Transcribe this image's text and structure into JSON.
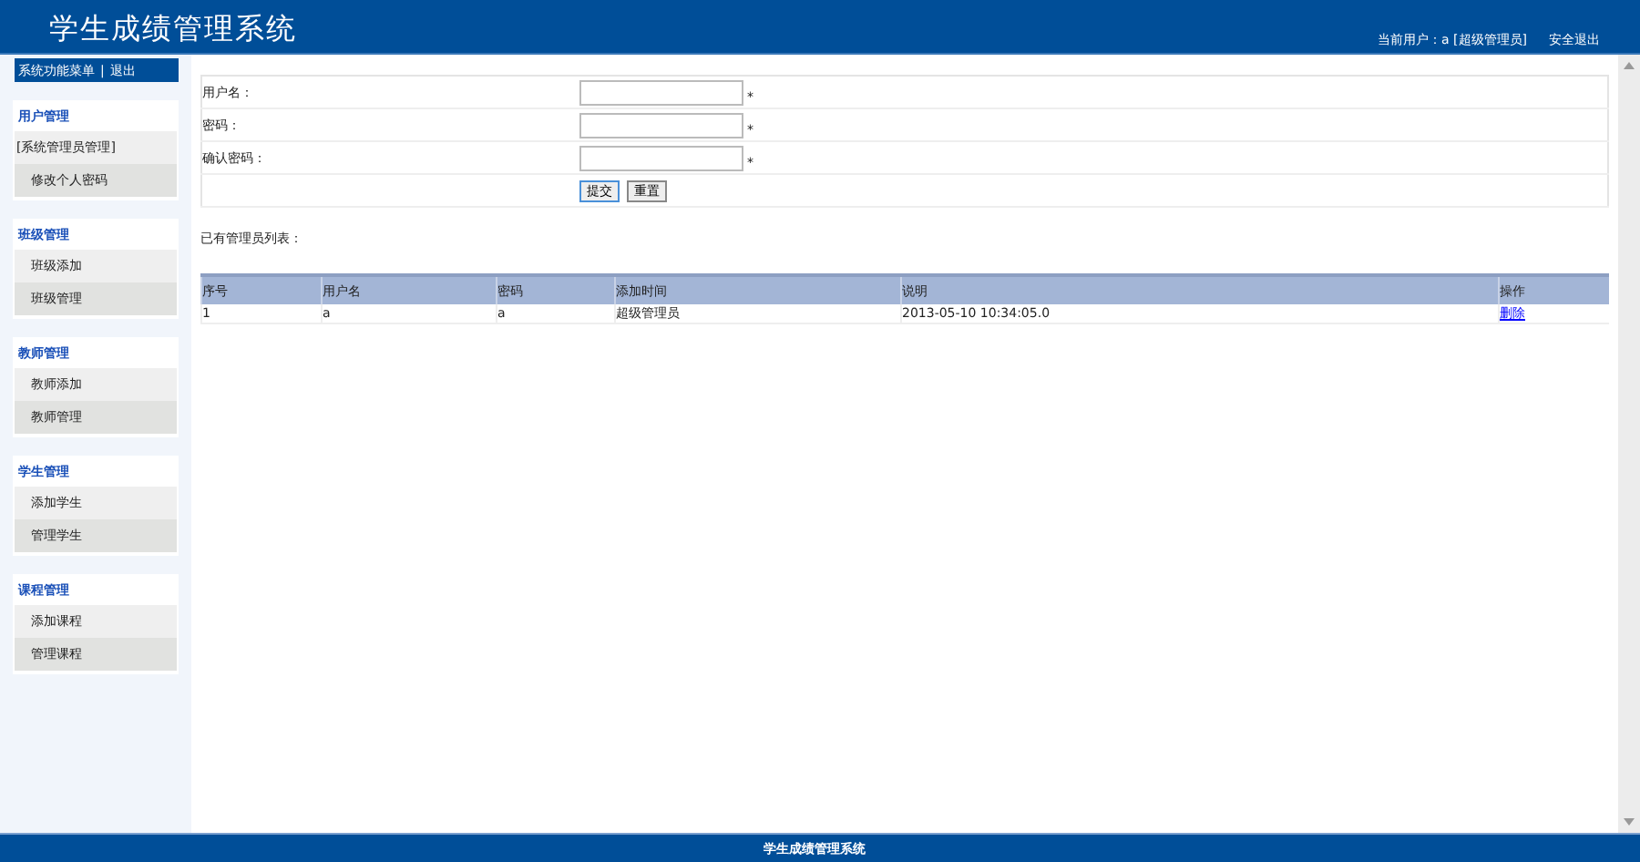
{
  "header": {
    "title": "学生成绩管理系统",
    "current_user": "当前用户：a [超级管理员]",
    "logout": "安全退出"
  },
  "sidebar": {
    "menu_title": "系统功能菜单",
    "menu_separator": "|",
    "menu_logout": "退出",
    "groups": [
      {
        "title": "用户管理",
        "items": [
          "[系统管理员管理]",
          "修改个人密码"
        ]
      },
      {
        "title": "班级管理",
        "items": [
          "班级添加",
          "班级管理"
        ]
      },
      {
        "title": "教师管理",
        "items": [
          "教师添加",
          "教师管理"
        ]
      },
      {
        "title": "学生管理",
        "items": [
          "添加学生",
          "管理学生"
        ]
      },
      {
        "title": "课程管理",
        "items": [
          "添加课程",
          "管理课程"
        ]
      }
    ]
  },
  "form": {
    "fields": [
      {
        "label": "用户名：",
        "required": "*"
      },
      {
        "label": "密码：",
        "required": "*"
      },
      {
        "label": "确认密码：",
        "required": "*"
      }
    ],
    "buttons": [
      {
        "label": "提交",
        "focused": true
      },
      {
        "label": "重置",
        "focused": false
      }
    ]
  },
  "list": {
    "title": "已有管理员列表：",
    "columns": [
      "序号",
      "用户名",
      "密码",
      "添加时间",
      "说明",
      "操作"
    ],
    "rows": [
      {
        "cells": [
          "1",
          "a",
          "a",
          "超级管理员",
          "2013-05-10 10:34:05.0"
        ],
        "action": "删除"
      }
    ]
  },
  "footer": {
    "text": "学生成绩管理系统"
  }
}
